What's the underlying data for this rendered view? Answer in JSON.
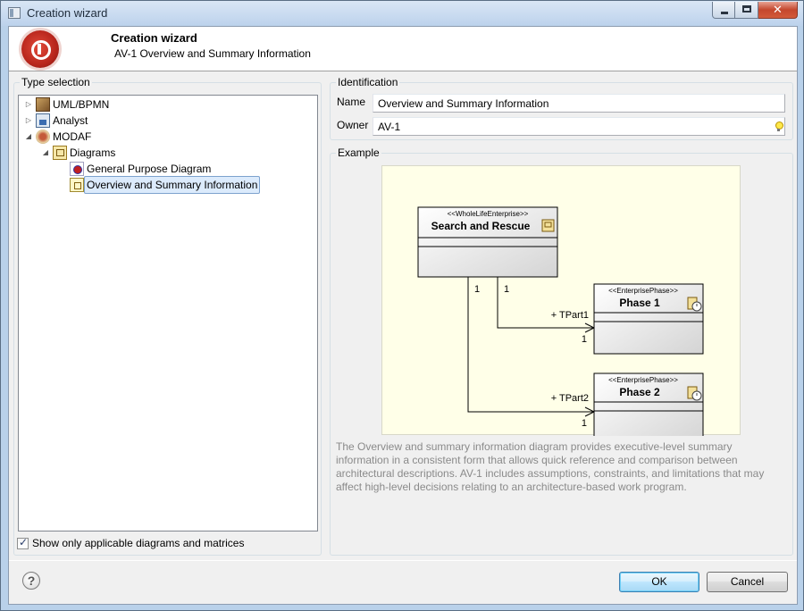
{
  "window": {
    "title": "Creation wizard"
  },
  "banner": {
    "title": "Creation wizard",
    "subtitle": "AV-1 Overview and Summary Information"
  },
  "type_selection": {
    "legend": "Type selection",
    "tree": [
      {
        "label": "UML/BPMN",
        "icon": "uml-package-icon",
        "expander": "collapsed"
      },
      {
        "label": "Analyst",
        "icon": "analyst-icon",
        "expander": "collapsed"
      },
      {
        "label": "MODAF",
        "icon": "modaf-icon",
        "expander": "expanded"
      },
      {
        "label": "Diagrams",
        "icon": "diagrams-folder-icon",
        "expander": "expanded"
      },
      {
        "label": "General Purpose Diagram",
        "icon": "general-purpose-diagram-icon",
        "expander": "none"
      },
      {
        "label": "Overview and Summary Information",
        "icon": "overview-diagram-icon",
        "expander": "none",
        "selected": true
      }
    ],
    "filter_checkbox": {
      "label": "Show only applicable diagrams and matrices",
      "checked": true
    }
  },
  "identification": {
    "legend": "Identification",
    "name_label": "Name",
    "name_value": "Overview and Summary Information",
    "owner_label": "Owner",
    "owner_value": "AV-1"
  },
  "example": {
    "legend": "Example",
    "diagram": {
      "root": {
        "stereotype": "<<WholeLifeEnterprise>>",
        "name": "Search and Rescue"
      },
      "phase1": {
        "stereotype": "<<EnterprisePhase>>",
        "name": "Phase 1"
      },
      "phase2": {
        "stereotype": "<<EnterprisePhase>>",
        "name": "Phase 2"
      },
      "link1": {
        "role": "+ TPart1",
        "source_mult": "1",
        "target_mult": "1"
      },
      "link2": {
        "role": "+ TPart2",
        "source_mult": "1",
        "target_mult": "1"
      }
    },
    "description": "The Overview and summary information diagram provides executive-level summary information in a consistent form that allows quick reference and comparison between architectural descriptions. AV-1 includes assumptions, constraints, and limitations that may affect high-level decisions relating to an architecture-based work program."
  },
  "footer": {
    "ok_label": "OK",
    "cancel_label": "Cancel",
    "help_glyph": "?"
  }
}
